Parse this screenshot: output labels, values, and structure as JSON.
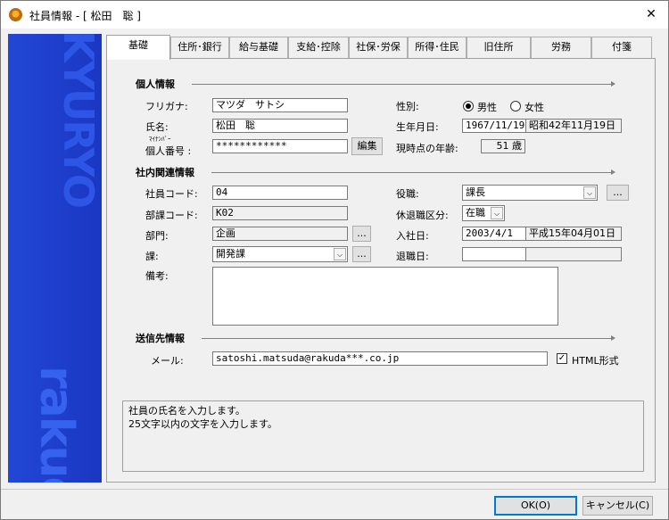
{
  "window": {
    "title": "社員情報 - [ 松田　聡 ]",
    "close_glyph": "✕"
  },
  "sidebar": {
    "top_text": "KYURYO",
    "bottom_text": "rakuda"
  },
  "tabs": [
    {
      "label": "基礎"
    },
    {
      "label": "住所･銀行"
    },
    {
      "label": "給与基礎"
    },
    {
      "label": "支給･控除"
    },
    {
      "label": "社保･労保"
    },
    {
      "label": "所得･住民"
    },
    {
      "label": "旧住所"
    },
    {
      "label": "労務"
    },
    {
      "label": "付箋"
    }
  ],
  "personal": {
    "section_title": "個人情報",
    "furigana_label": "フリガナ:",
    "furigana_value": "マツダ　サトシ",
    "name_label": "氏名:",
    "name_value": "松田　聡",
    "mynumber_ruby": "ﾏｲﾅﾝﾊﾞｰ",
    "mynumber_label": "個人番号 :",
    "mynumber_value": "************",
    "edit_button": "編集",
    "gender_label": "性別:",
    "gender_male": "男性",
    "gender_female": "女性",
    "birth_label": "生年月日:",
    "birth_value": "1967/11/19",
    "birth_era": "昭和42年11月19日",
    "age_label": "現時点の年齢:",
    "age_value": "51 歳"
  },
  "company": {
    "section_title": "社内関連情報",
    "emp_code_label": "社員コード:",
    "emp_code_value": "04",
    "dept_code_label": "部課コード:",
    "dept_code_value": "K02",
    "department_label": "部門:",
    "department_value": "企画",
    "section_label": "課:",
    "section_value": "開発課",
    "position_label": "役職:",
    "position_value": "課長",
    "leave_label": "休退職区分:",
    "leave_value": "在職",
    "join_label": "入社日:",
    "join_value": "2003/4/1",
    "join_era": "平成15年04月01日",
    "retire_label": "退職日:",
    "retire_value": "",
    "notes_label": "備考:",
    "browse_glyph": "...",
    "dropdown_glyph": "⌵"
  },
  "contact": {
    "section_title": "送信先情報",
    "mail_label": "メール:",
    "mail_value": "satoshi.matsuda@rakuda***.co.jp",
    "html_label": "HTML形式",
    "check_glyph": "✓"
  },
  "help": {
    "line1": "社員の氏名を入力します。",
    "line2": "25文字以内の文字を入力します。"
  },
  "buttons": {
    "ok": "OK(O)",
    "cancel": "キャンセル(C)"
  }
}
